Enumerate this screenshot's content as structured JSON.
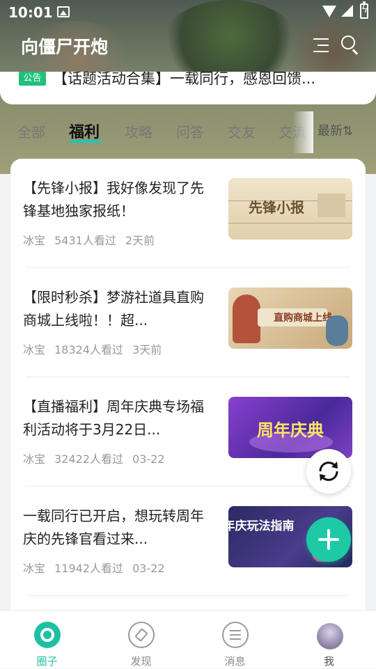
{
  "status_bar": {
    "time": "10:01"
  },
  "header": {
    "title": "向僵尸开炮"
  },
  "notice": {
    "badge": "公告",
    "text": "【话题活动合集】一载同行，感恩回馈..."
  },
  "tabs": [
    "全部",
    "福利",
    "攻略",
    "问答",
    "交友",
    "交流"
  ],
  "active_tab": "福利",
  "sort_label": "最新⇅",
  "posts": [
    {
      "title": "【先锋小报】我好像发现了先锋基地独家报纸！",
      "author": "冰宝",
      "views": "5431人看过",
      "time": "2天前",
      "thumb_text": "先锋小报"
    },
    {
      "title": "【限时秒杀】梦游社道具直购商城上线啦！！超...",
      "author": "冰宝",
      "views": "18324人看过",
      "time": "3天前",
      "thumb_text": "直购商城上线"
    },
    {
      "title": "【直播福利】周年庆典专场福利活动将于3月22日...",
      "author": "冰宝",
      "views": "32422人看过",
      "time": "03-22",
      "thumb_text": "周年庆典"
    },
    {
      "title": "一载同行已开启，想玩转周年庆的先锋官看过来...",
      "author": "冰宝",
      "views": "11942人看过",
      "time": "03-22",
      "thumb_text": "周年庆玩法指南"
    }
  ],
  "bottom_nav": [
    {
      "label": "圈子",
      "icon": "circle-icon"
    },
    {
      "label": "发现",
      "icon": "compass-icon"
    },
    {
      "label": "消息",
      "icon": "message-icon"
    },
    {
      "label": "我",
      "icon": "avatar-icon"
    }
  ],
  "colors": {
    "accent": "#1fbfa3",
    "badge": "#21c07b",
    "fab": "#1ecaa6"
  }
}
